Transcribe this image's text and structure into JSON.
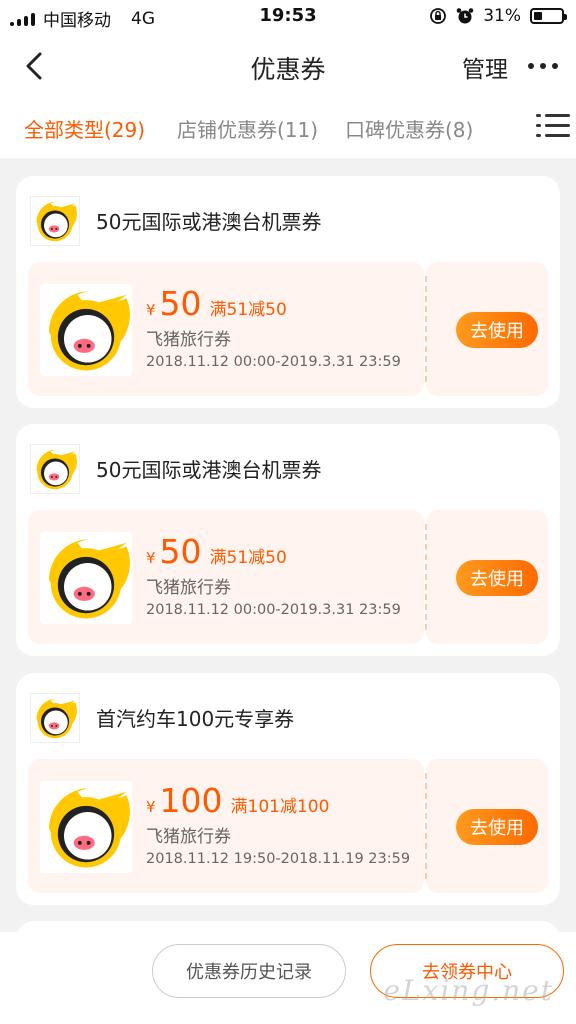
{
  "status_bar": {
    "carrier": "中国移动",
    "network": "4G",
    "time": "19:53",
    "battery": "31%",
    "battery_level": 0.31
  },
  "header": {
    "back_icon": "chevron-left-icon",
    "title": "优惠券",
    "manage_label": "管理",
    "more_icon": "more-dots-icon"
  },
  "tabs": [
    {
      "label": "全部类型(29)",
      "active": true
    },
    {
      "label": "店铺优惠券(11)",
      "active": false
    },
    {
      "label": "口碑优惠券(8)",
      "active": false
    }
  ],
  "filter_icon": "list-filter-icon",
  "coupons": [
    {
      "name": "50元国际或港澳台机票券",
      "currency": "¥",
      "amount": "50",
      "condition": "满51减50",
      "issuer": "飞猪旅行券",
      "validity": "2018.11.12 00:00-2019.3.31 23:59",
      "action": "去使用"
    },
    {
      "name": "50元国际或港澳台机票券",
      "currency": "¥",
      "amount": "50",
      "condition": "满51减50",
      "issuer": "飞猪旅行券",
      "validity": "2018.11.12 00:00-2019.3.31 23:59",
      "action": "去使用"
    },
    {
      "name": "首汽约车100元专享券",
      "currency": "¥",
      "amount": "100",
      "condition": "满101减100",
      "issuer": "飞猪旅行券",
      "validity": "2018.11.12 19:50-2018.11.19 23:59",
      "action": "去使用"
    }
  ],
  "footer": {
    "history_label": "优惠券历史记录",
    "center_label": "去领券中心",
    "watermark": "eLxing.net"
  },
  "colors": {
    "accent": "#ff5a00",
    "button_gradient_start": "#ff9a1e",
    "coupon_bg": "#fff4ef",
    "brand_yellow": "#ffc800"
  }
}
